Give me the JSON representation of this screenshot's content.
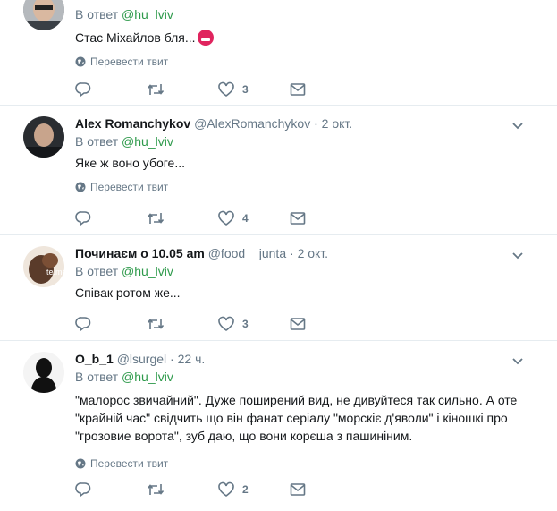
{
  "tweets": [
    {
      "name": "",
      "handle": "",
      "time": "",
      "reply_prefix": "В ответ",
      "reply_to": "@hu_lviv",
      "text": "Стас Міхайлов бля...",
      "translate": "Перевести твит",
      "likes": "3",
      "avatar_icon": "person-photo"
    },
    {
      "name": "Alex Romanchykov",
      "handle": "@AlexRomanchykov",
      "time": "2 окт.",
      "reply_prefix": "В ответ",
      "reply_to": "@hu_lviv",
      "text": "Яке ж воно убоге...",
      "translate": "Перевести твит",
      "likes": "4",
      "avatar_icon": "person-photo"
    },
    {
      "name": "Починаєм о 10.05 am",
      "handle": "@food__junta",
      "time": "2 окт.",
      "reply_prefix": "В ответ",
      "reply_to": "@hu_lviv",
      "text": "Співак ротом же...",
      "translate": "Перевести твит",
      "likes": "3",
      "avatar_icon": "cartoon-photo"
    },
    {
      "name": "O_b_1",
      "handle": "@lsurgel",
      "time": "22 ч.",
      "reply_prefix": "В ответ",
      "reply_to": "@hu_lviv",
      "text": "\"малорос звичайний\". Дуже поширений вид, не дивуйтеся так сильно. А оте \"крайній час\" свідчить що він фанат серіалу \"морскіє д'яволи\" і кіношкі про \"грозовие ворота\", зуб даю, що вони корєша з пашиніним.",
      "translate": "Перевести твит",
      "likes": "2",
      "avatar_icon": "silhouette-photo"
    }
  ],
  "colors": {
    "link": "#2e9a4b",
    "muted": "#657786",
    "divider": "#e6ecf0"
  }
}
